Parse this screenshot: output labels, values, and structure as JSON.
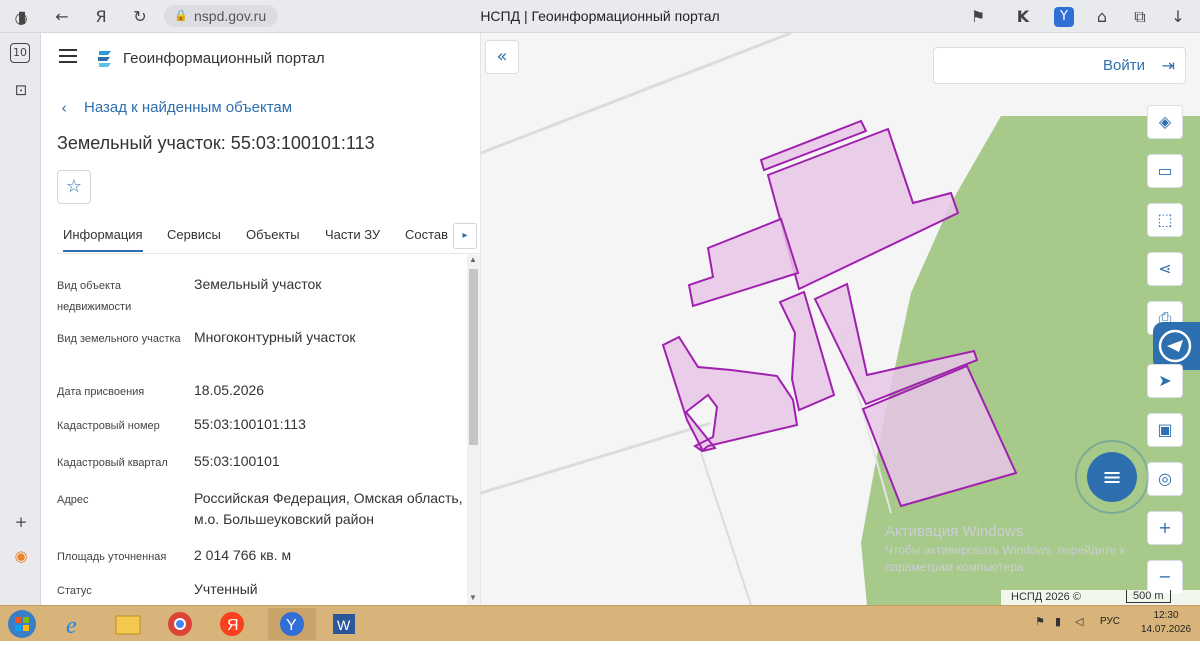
{
  "browser": {
    "url": "nspd.gov.ru",
    "tab_title": "НСПД | Геоинформационный портал",
    "side_counter": "10"
  },
  "panel": {
    "portal_title": "Геоинформационный портал",
    "back_link": "Назад к найденным объектам",
    "object_title": "Земельный участок: 55:03:100101:113",
    "tabs": [
      {
        "label": "Информация",
        "active": true
      },
      {
        "label": "Сервисы",
        "active": false
      },
      {
        "label": "Объекты",
        "active": false
      },
      {
        "label": "Части ЗУ",
        "active": false
      },
      {
        "label": "Состав",
        "active": false
      }
    ],
    "rows": [
      {
        "label": "Вид объекта недвижимости",
        "value": "Земельный участок"
      },
      {
        "label": "Вид земельного участка",
        "value": "Многоконтурный участок"
      },
      {
        "label": "Дата присвоения",
        "value": "18.05.2026"
      },
      {
        "label": "Кадастровый номер",
        "value": "55:03:100101:113"
      },
      {
        "label": "Кадастровый квартал",
        "value": "55:03:100101"
      },
      {
        "label": "Адрес",
        "value": "Российская Федерация, Омская область, м.о. Большеуковский район"
      },
      {
        "label": "Площадь уточненная",
        "value": "2 014 766 кв. м"
      },
      {
        "label": "Статус",
        "value": "Учтенный"
      }
    ]
  },
  "map": {
    "login_label": "Войти",
    "watermark_title": "Активация Windows",
    "watermark_line1": "Чтобы активировать Windows, перейдите к",
    "watermark_line2": "параметрам компьютера.",
    "copyright": "НСПД 2026 ©",
    "scale": "500 m",
    "colors": {
      "parcel_fill": "#e6c6e6",
      "parcel_stroke": "#a020b0",
      "field_green": "#a7c98a",
      "accent_blue": "#2e6fb0"
    },
    "tools": [
      "layers-icon",
      "ruler-icon",
      "select-area-icon",
      "share-icon",
      "print-icon",
      "navigate-icon",
      "minimap-icon",
      "locate-icon",
      "zoom-in-icon",
      "zoom-out-icon"
    ]
  },
  "taskbar": {
    "lang": "РУС",
    "time": "12:30",
    "date": "14.07.2026"
  }
}
